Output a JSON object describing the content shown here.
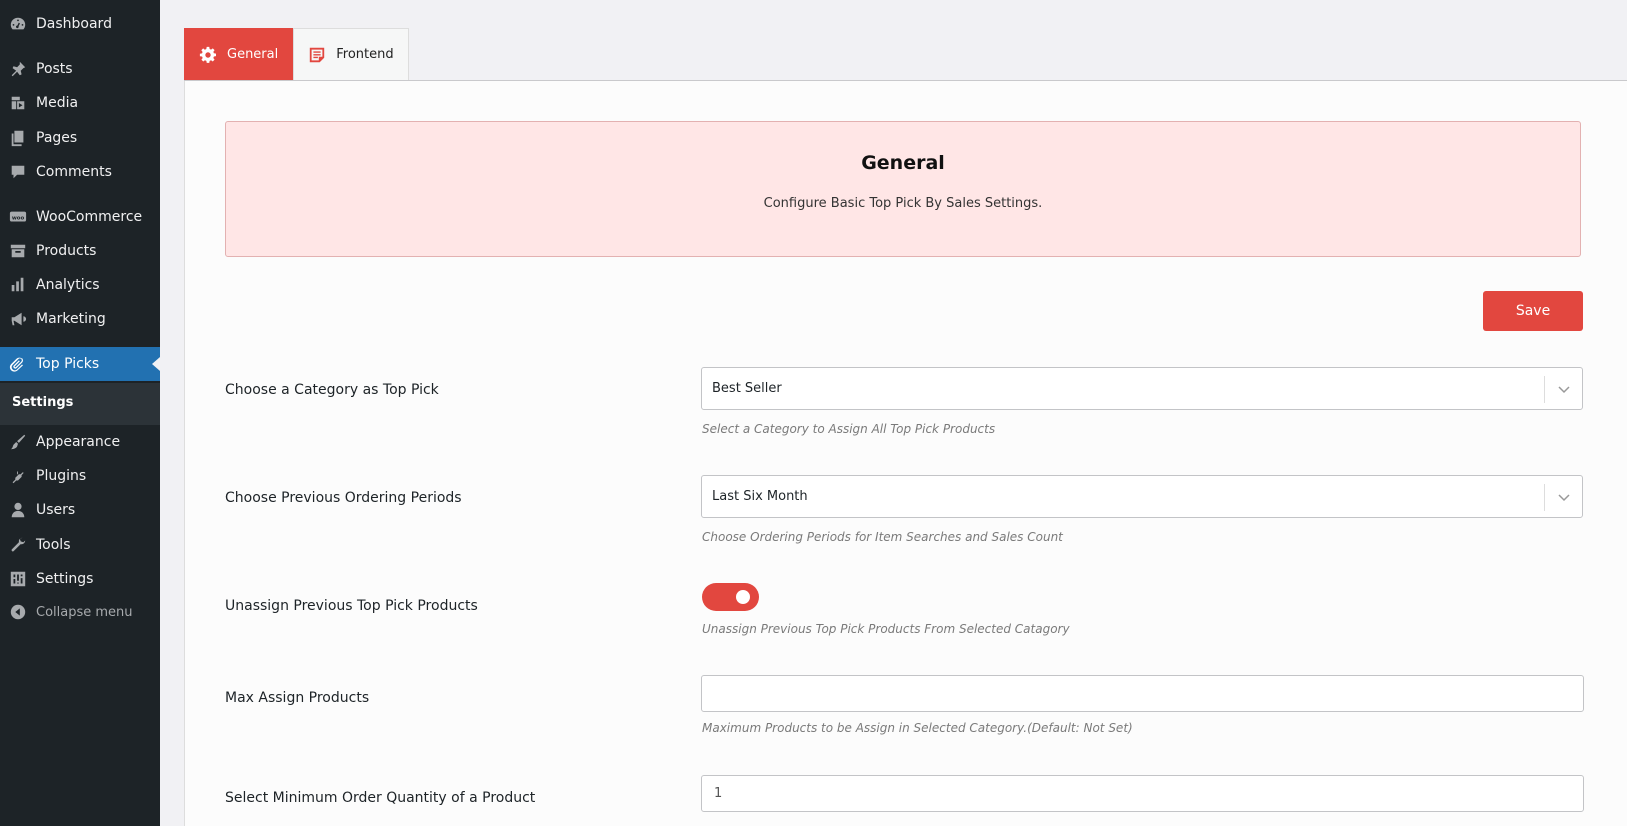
{
  "sidebar": {
    "items": [
      {
        "label": "Dashboard",
        "icon": "dashboard-icon"
      },
      {
        "label": "Posts",
        "icon": "pin-icon"
      },
      {
        "label": "Media",
        "icon": "media-icon"
      },
      {
        "label": "Pages",
        "icon": "pages-icon"
      },
      {
        "label": "Comments",
        "icon": "comment-icon"
      },
      {
        "label": "WooCommerce",
        "icon": "woo-icon"
      },
      {
        "label": "Products",
        "icon": "archive-icon"
      },
      {
        "label": "Analytics",
        "icon": "bar-chart-icon"
      },
      {
        "label": "Marketing",
        "icon": "megaphone-icon"
      },
      {
        "label": "Top Picks",
        "icon": "paperclip-icon",
        "active": true
      },
      {
        "label": "Appearance",
        "icon": "brush-icon"
      },
      {
        "label": "Plugins",
        "icon": "plug-icon"
      },
      {
        "label": "Users",
        "icon": "user-icon"
      },
      {
        "label": "Tools",
        "icon": "wrench-icon"
      },
      {
        "label": "Settings",
        "icon": "sliders-icon"
      }
    ],
    "submenu_label": "Settings",
    "collapse_label": "Collapse menu"
  },
  "tabs": [
    {
      "label": "General",
      "icon": "gear-icon",
      "active": true
    },
    {
      "label": "Frontend",
      "icon": "document-icon",
      "active": false
    }
  ],
  "banner": {
    "title": "General",
    "subtitle": "Configure Basic Top Pick By Sales Settings."
  },
  "save_label": "Save",
  "fields": {
    "category": {
      "label": "Choose a Category as Top Pick",
      "value": "Best Seller",
      "help": "Select a Category to Assign All Top Pick Products"
    },
    "periods": {
      "label": "Choose Previous Ordering Periods",
      "value": "Last Six Month",
      "help": "Choose Ordering Periods for Item Searches and Sales Count"
    },
    "unassign": {
      "label": "Unassign Previous Top Pick Products",
      "enabled": true,
      "help": "Unassign Previous Top Pick Products From Selected Catagory"
    },
    "max_assign": {
      "label": "Max Assign Products",
      "value": "",
      "help": "Maximum Products to be Assign in Selected Category.(Default: Not Set)"
    },
    "min_qty": {
      "label": "Select Minimum Order Quantity of a Product",
      "value": "1"
    }
  },
  "colors": {
    "accent": "#e2473f",
    "sidebar_bg": "#1d2327",
    "active_menu": "#2271b1",
    "banner_bg": "#ffe6e6"
  }
}
